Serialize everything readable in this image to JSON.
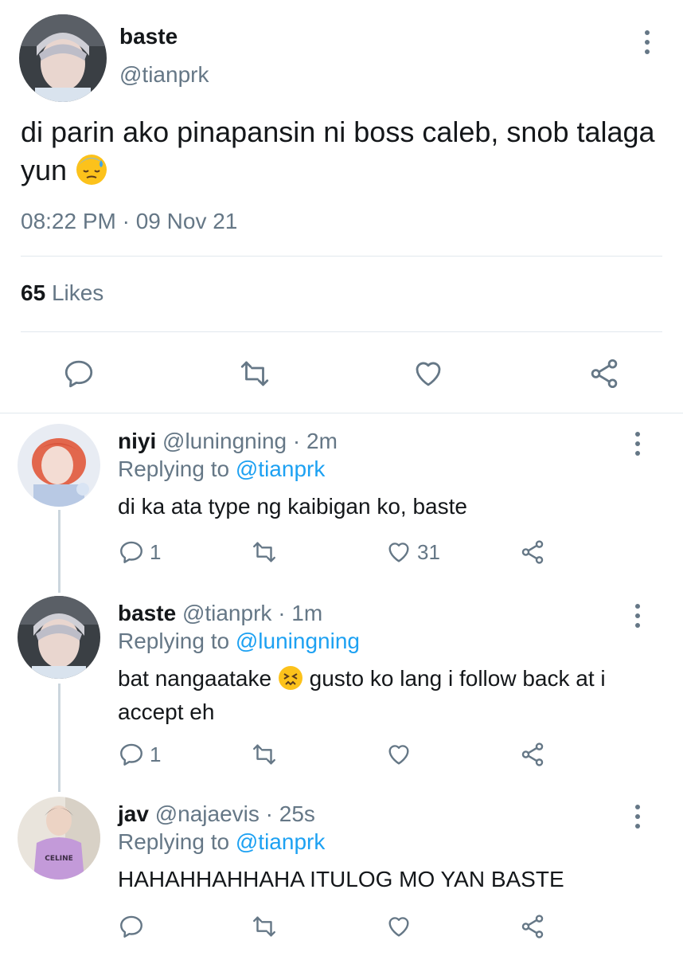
{
  "main_tweet": {
    "name": "baste",
    "handle": "@tianprk",
    "text": "di parin ako pinapansin ni boss caleb, snob talaga yun",
    "timestamp": "08:22 PM · 09 Nov 21",
    "likes_count": "65",
    "likes_label": "Likes",
    "actions": [
      "reply-icon",
      "retweet-icon",
      "like-icon",
      "share-icon"
    ]
  },
  "replies": [
    {
      "name": "niyi",
      "handle": "@luningning",
      "time": "· 2m",
      "replying_prefix": "Replying to",
      "replying_to": "@tianprk",
      "text": "di ka ata type ng kaibigan ko, baste",
      "reply_count": "1",
      "like_count": "31"
    },
    {
      "name": "baste",
      "handle": "@tianprk",
      "time": "· 1m",
      "replying_prefix": "Replying to",
      "replying_to": "@luningning",
      "text_before_emoji": "bat nangaatake",
      "text_after_emoji": "gusto ko lang i follow back at i accept eh",
      "reply_count": "1",
      "like_count": ""
    },
    {
      "name": "jav",
      "handle": "@najaevis",
      "time": "· 25s",
      "replying_prefix": "Replying to",
      "replying_to": "@tianprk",
      "text": "HAHAHHAHHAHA ITULOG MO YAN BASTE",
      "reply_count": "",
      "like_count": "",
      "avatar_shirt_text": "CELINE"
    }
  ],
  "colors": {
    "text": "#14171a",
    "secondary": "#657786",
    "link": "#1da1f2",
    "divider": "#e1e8ed",
    "thread_line": "#ccd6dd"
  }
}
